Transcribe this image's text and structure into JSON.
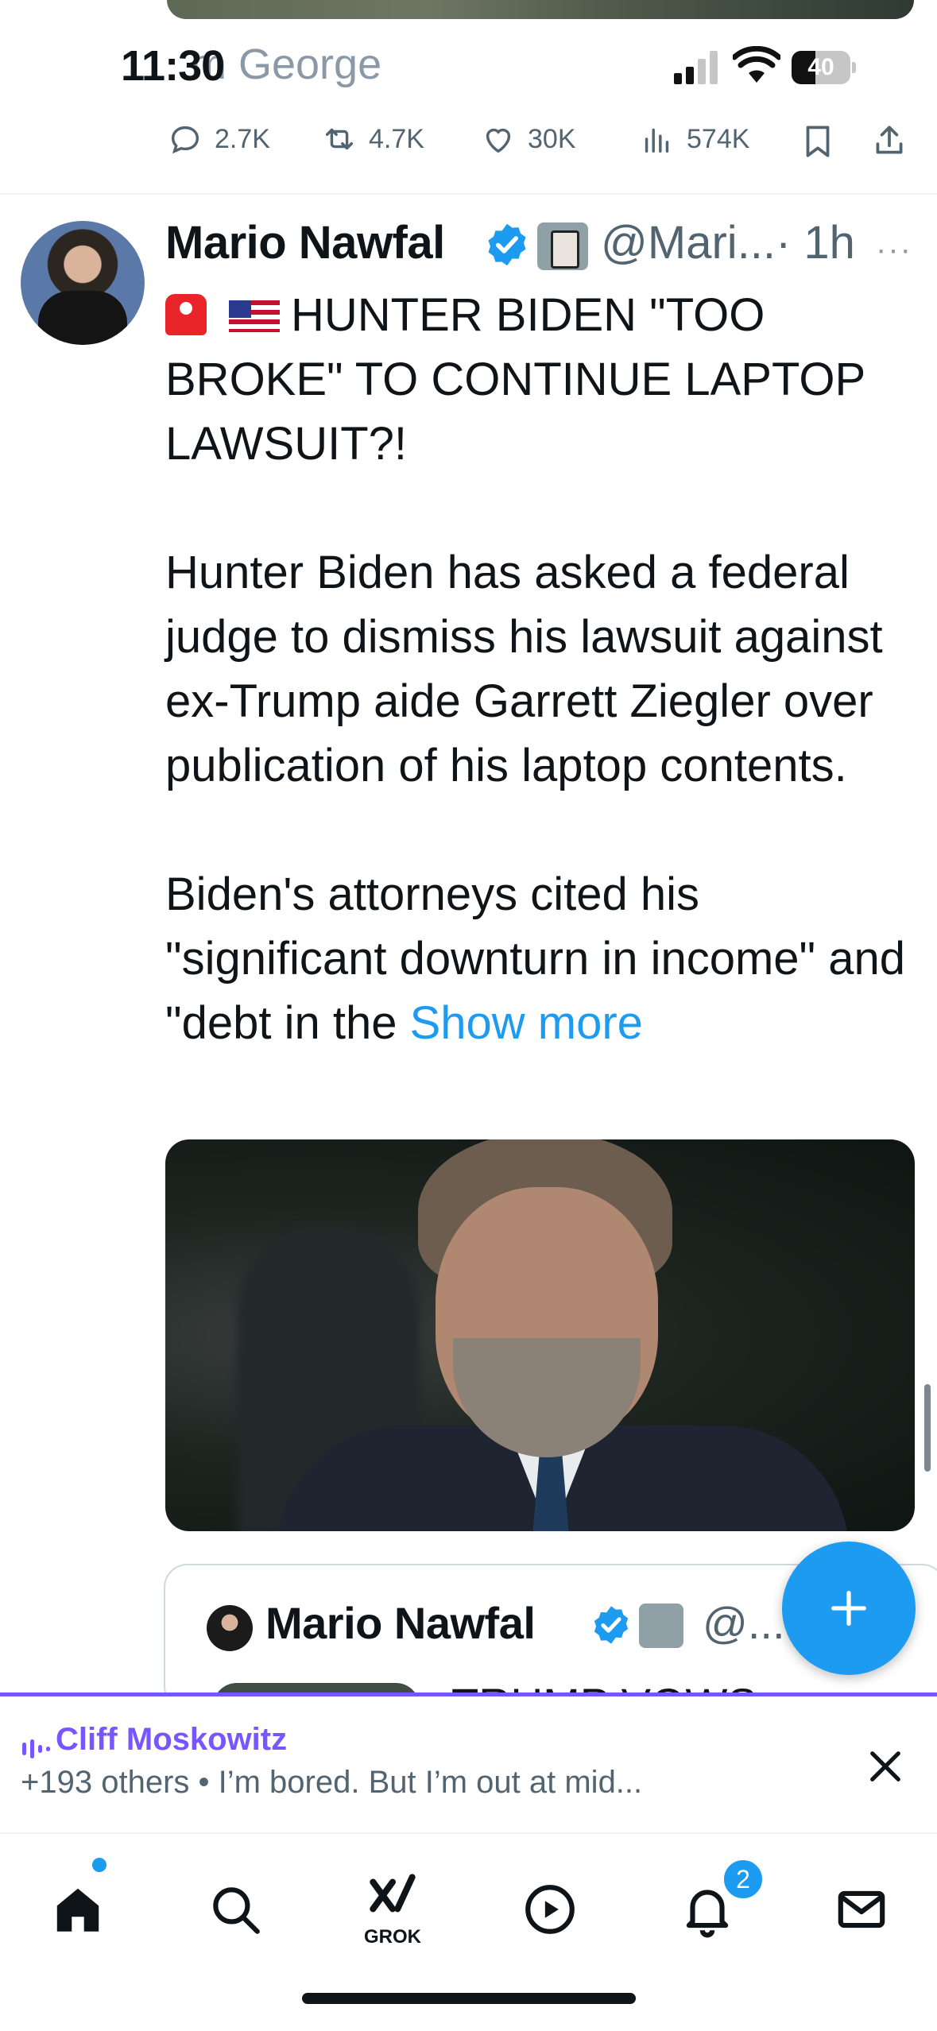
{
  "status_bar": {
    "time": "11:30",
    "battery": "40",
    "battery_level": 0.4
  },
  "previous_tweet": {
    "from_text": "m George",
    "actions": {
      "replies": "2.7K",
      "reposts": "4.7K",
      "likes": "30K",
      "views": "574K"
    }
  },
  "tweet": {
    "author_name": "Mario Nawfal",
    "handle": "@Mari...",
    "time": "· 1h",
    "more": "···",
    "emoji": [
      "siren-emoji",
      "us-flag-emoji"
    ],
    "headline": "HUNTER BIDEN \"TOO BROKE\" TO CONTINUE LAPTOP LAWSUIT?!",
    "paragraph_1": "Hunter Biden has asked a federal judge to dismiss his lawsuit against ex-Trump aide Garrett Ziegler over publication of his laptop contents.",
    "paragraph_2": "Biden's attorneys cited his \"significant downturn in income\" and \"debt in the ",
    "show_more": "Show more"
  },
  "quoted_tweet": {
    "author_name": "Mario Nawfal",
    "handle": "@...",
    "text_preview": "TRUMP VOWS"
  },
  "spaces": {
    "host": "Cliff Moskowitz",
    "subtitle": "+193 others • I’m bored. But I’m out at mid..."
  },
  "nav": {
    "grok_label": "GROK",
    "notifications_count": "2"
  },
  "colors": {
    "accent": "#1d9bf0",
    "spaces": "#7856ff",
    "text": "#0f1419",
    "secondary": "#536471"
  }
}
